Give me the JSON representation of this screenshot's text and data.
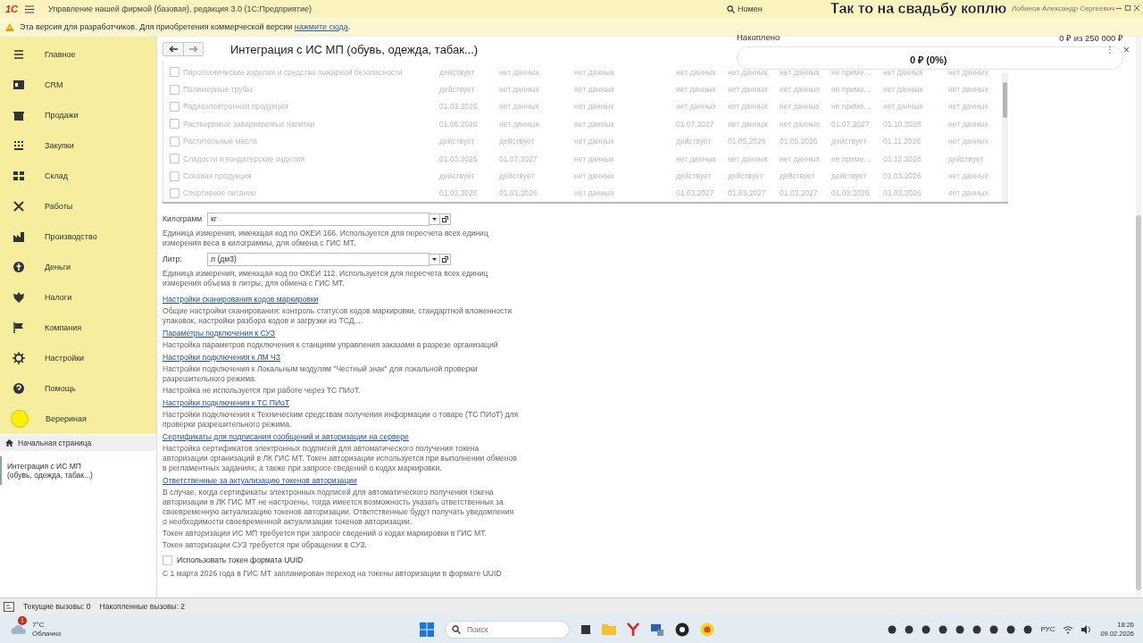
{
  "app_bar": {
    "logo": "1С",
    "title": "Управление нашей фирмой (базовая), редакция 3.0  (1С:Предприятие)",
    "search": {
      "value": "Номен"
    },
    "user": "Лобанов Александр Сергеевич"
  },
  "notice": {
    "text": "Эта версия для разработчиков. Для приобретения коммерческой версии ",
    "link": "нажмите сюда",
    "tail": "."
  },
  "savings_widget": {
    "title": "Так то на свадьбу коплю",
    "label": "Накоплено",
    "amount": "0 ₽ из 250 000 ₽",
    "progress_text": "0 ₽ (0%)",
    "level": 0,
    "menu": "⋮",
    "close": "×"
  },
  "sidebar": {
    "items": [
      {
        "label": "Главное"
      },
      {
        "label": "CRM"
      },
      {
        "label": "Продажи"
      },
      {
        "label": "Закупки"
      },
      {
        "label": "Склад"
      },
      {
        "label": "Работы"
      },
      {
        "label": "Производство"
      },
      {
        "label": "Деньги"
      },
      {
        "label": "Налоги"
      },
      {
        "label": "Компания"
      },
      {
        "label": "Настройки"
      },
      {
        "label": "Помощь"
      },
      {
        "label": "Верериная"
      }
    ],
    "open_windows": [
      {
        "label": "Начальная страница",
        "selected": false
      },
      {
        "label": "Интеграция с ИС МП (обувь, одежда, табак...)",
        "selected": true
      }
    ]
  },
  "page": {
    "title": "Интеграция с ИС МП (обувь, одежда, табак...)",
    "table": {
      "disabled": true,
      "rows": [
        {
          "checked": false,
          "cells": [
            "Пиротехнические изделия и средства пожарной безопасности",
            "действует",
            "нет данных",
            "нет данных",
            "нет данных",
            "нет данных",
            "нет данных",
            "не приме...",
            "нет данных",
            "нет данных"
          ]
        },
        {
          "checked": false,
          "cells": [
            "Полимерные трубы",
            "действует",
            "нет данных",
            "нет данных",
            "нет данных",
            "нет данных",
            "нет данных",
            "не приме...",
            "нет данных",
            "нет данных"
          ]
        },
        {
          "checked": false,
          "cells": [
            "Радиоэлектронная продукция",
            "01.03.2026",
            "нет данных",
            "нет данных",
            "нет данных",
            "нет данных",
            "нет данных",
            "не приме...",
            "нет данных",
            "нет данных"
          ]
        },
        {
          "checked": false,
          "cells": [
            "Растворимые завариваемые напитки",
            "01.06.2026",
            "нет данных",
            "нет данных",
            "01.07.2027",
            "нет данных",
            "нет данных",
            "01.07.2027",
            "01.10.2028",
            "нет данных"
          ]
        },
        {
          "checked": false,
          "cells": [
            "Растительные масла",
            "действует",
            "действует",
            "нет данных",
            "действует",
            "01.05.2026",
            "01.05.2026",
            "действует",
            "01.11.2026",
            "нет данных"
          ]
        },
        {
          "checked": false,
          "cells": [
            "Сладости и кондитерские изделия",
            "01.03.2026",
            "01.07.2027",
            "нет данных",
            "нет данных",
            "нет данных",
            "нет данных",
            "не приме...",
            "01.12.2028",
            "действует"
          ]
        },
        {
          "checked": false,
          "cells": [
            "Соковая продукция",
            "действует",
            "действует",
            "нет данных",
            "действует",
            "действует",
            "действует",
            "действует",
            "01.03.2026",
            "нет данных"
          ]
        },
        {
          "checked": false,
          "cells": [
            "Спортивное питание",
            "01.03.2026",
            "01.03.2026",
            "нет данных",
            "01.03.2027",
            "01.03.2027",
            "01.03.2027",
            "01.03.2026",
            "01.03.2026",
            "нет данных"
          ]
        }
      ]
    },
    "fields": [
      {
        "label": "Килограмм",
        "value": "кг",
        "description": "Единица измерения, имеющая код по ОКЕИ 166. Используется для пересчета всех единиц измерения веса в килограммы, для обмена с ГИС МТ."
      },
      {
        "label": "Литр:",
        "value": "л (дм3)",
        "description": "Единица измерения, имеющая код по ОКЕИ 112. Используется для пересчета всех единиц измерения объема в литры, для обмена с ГИС МТ."
      }
    ],
    "sections": [
      {
        "link": "Настройки сканирования кодов маркировки",
        "description": [
          "Общие настройки сканирования: контроль статусов кодов маркировки, стандартной вложенности упаковок, настройки разбора кодов и загрузки из ТСД,..."
        ]
      },
      {
        "link": "Параметры подключения к СУЗ",
        "description": [
          "Настройка параметров подключения к станциям управления заказами в разрезе организаций"
        ]
      },
      {
        "link": "Настройки подключения к ЛМ ЧЗ",
        "description": [
          "Настройки подключения к Локальным модулям \"Честный знак\" для локальной проверки разрешительного режима.",
          "Настройка не используется при работе через ТС ПИоТ."
        ]
      },
      {
        "link": "Настройки подключения к ТС ПИоТ",
        "description": [
          "Настройки подключения к Техническим средствам получения информации о товаре (ТС ПИоТ) для проверки разрешительного режима."
        ]
      },
      {
        "link": "Сертификаты для подписания сообщений и авторизации на сервере",
        "description": [
          "Настройка сертификатов электронных подписей для автоматического получения токена авторизации организаций в ЛК ГИС МТ. Токен авторизации используется при выполнении обменов в регламентных заданиях, а также при запросе сведений о кодах маркировки."
        ]
      },
      {
        "link": "Ответственные за актуализацию токенов авторизации",
        "description": [
          "В случае, когда сертификаты электронных подписей для автоматического получения токена авторизации в ЛК ГИС МТ не настроены, тогда имеется возможность указать ответственных за своевременную актуализацию токенов авторизации. Ответственные будут получать уведомления о необходимости своевременной актуализации токенов авторизации.",
          "Токен авторизации ИС МП требуется при запросе сведений о кодах маркировки в ГИС МТ.",
          "Токен авторизации СУЗ требуется при обращении в СУЗ."
        ]
      }
    ],
    "uuid_option": {
      "label": "Использовать токен формата UUID",
      "checked": false,
      "note": "С 1 марта 2026 года в ГИС МТ запланирован переход на токены авторизации в формате UUID"
    }
  },
  "status_bar": {
    "current": "Текущие вызовы: 0",
    "accumulated": "Накопленные вызовы: 2"
  },
  "taskbar": {
    "weather": {
      "badge": "1",
      "temperature": "7°C",
      "condition": "Облачно"
    },
    "search": {
      "placeholder": "Поиск"
    },
    "language": "РУС",
    "time": "18:26",
    "date": "09.02.2026"
  }
}
